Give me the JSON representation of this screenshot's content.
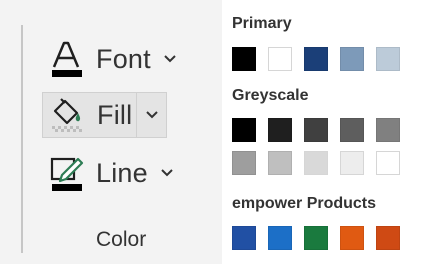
{
  "ribbon": {
    "font_label": "Font",
    "fill_label": "Fill",
    "line_label": "Line",
    "group_title": "Color"
  },
  "palette": {
    "primary_title": "Primary",
    "primary_colors": [
      "#000000",
      "#ffffff",
      "#1b3f78",
      "#7d9ab9",
      "#bccbd9"
    ],
    "greyscale_title": "Greyscale",
    "greyscale_row1": [
      "#000000",
      "#1f1f1f",
      "#404040",
      "#5e5e5e",
      "#808080"
    ],
    "greyscale_row2": [
      "#9e9e9e",
      "#bfbfbf",
      "#d9d9d9",
      "#ededed",
      "#ffffff"
    ],
    "products_title": "empower Products",
    "products_colors": [
      "#2150a4",
      "#1c6fc7",
      "#1a7a3e",
      "#e05a12",
      "#cf4a14"
    ]
  },
  "icons": {
    "font": "font-color-icon",
    "fill": "fill-bucket-icon",
    "line": "line-pen-icon",
    "caret": "chevron-down-icon"
  },
  "colors": {
    "font_underline": "#000000",
    "fill_accent": "#2e7d55"
  }
}
